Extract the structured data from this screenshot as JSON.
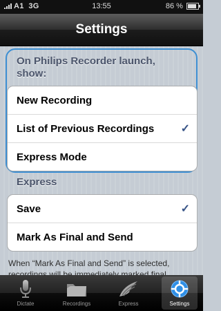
{
  "status": {
    "carrier": "A1",
    "network": "3G",
    "time": "13:55",
    "battery": "86 %"
  },
  "nav": {
    "title": "Settings"
  },
  "launch": {
    "header_line1": "On Philips Recorder launch,",
    "header_line2": "show:",
    "options": [
      {
        "label": "New Recording",
        "checked": false
      },
      {
        "label": "List of Previous Recordings",
        "checked": true
      },
      {
        "label": "Express Mode",
        "checked": false
      }
    ]
  },
  "express": {
    "header": "Express",
    "options": [
      {
        "label": "Save",
        "checked": true
      },
      {
        "label": "Mark As Final and Send",
        "checked": false
      }
    ]
  },
  "footnote": "When “Mark As Final and Send” is selected, recordings will be immediately marked final",
  "check_glyph": "✓",
  "tabs": [
    {
      "label": "Dictate",
      "icon": "microphone-icon",
      "active": false
    },
    {
      "label": "Recordings",
      "icon": "folder-icon",
      "active": false
    },
    {
      "label": "Express",
      "icon": "swoosh-icon",
      "active": false
    },
    {
      "label": "Settings",
      "icon": "gear-icon",
      "active": true
    }
  ],
  "colors": {
    "accent": "#3d8fd3",
    "check": "#385487",
    "header_text": "#4c566c"
  }
}
